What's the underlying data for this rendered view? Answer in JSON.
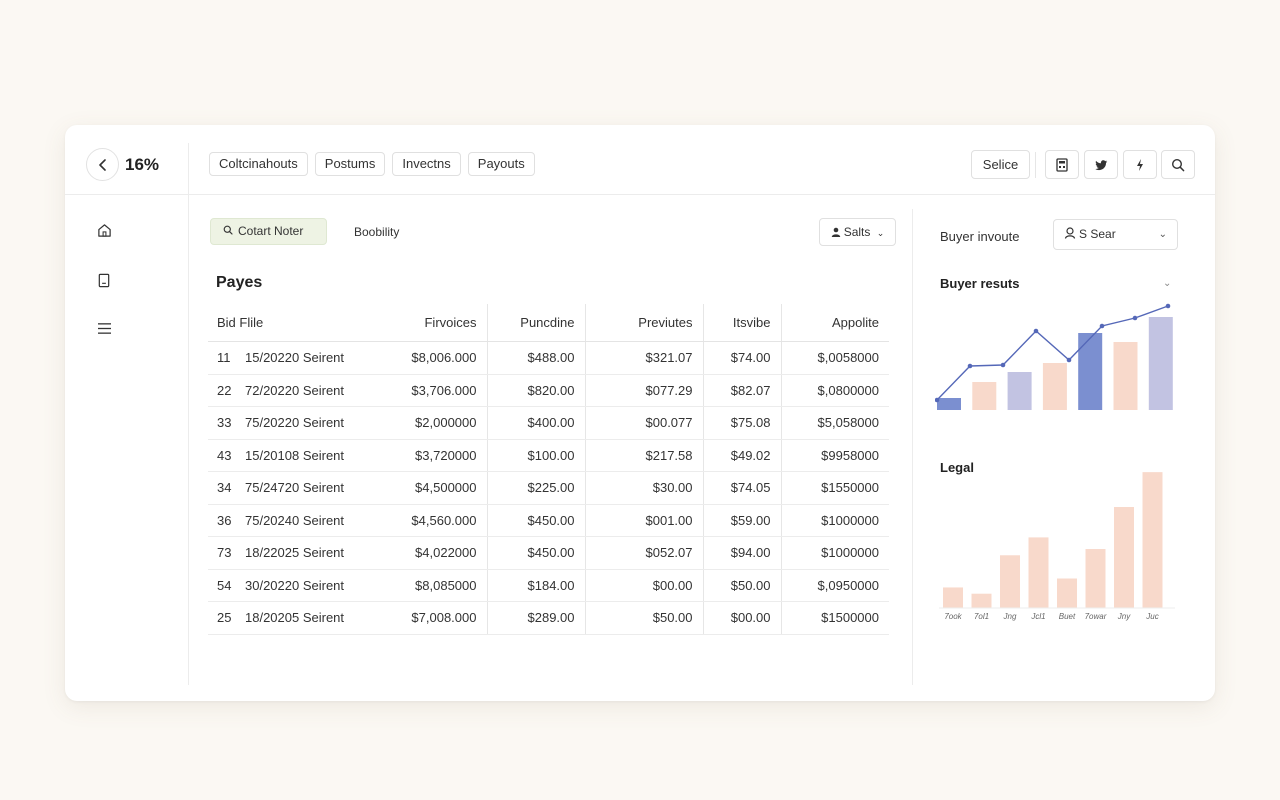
{
  "header": {
    "zoom": "16%",
    "tabs": [
      "Coltcinahouts",
      "Postums",
      "Invectns",
      "Payouts"
    ],
    "select_label": "Selice"
  },
  "icons": {
    "back": "back-arrow-icon",
    "toolbar": [
      "calculator-icon",
      "twitter-bird-icon",
      "lightning-icon",
      "search-icon"
    ],
    "sidebar": [
      "home-icon",
      "document-icon",
      "menu-icon"
    ]
  },
  "filters": {
    "chip_label": "Cotart Noter",
    "visibility_label": "Boobility",
    "sales_label": "Salts"
  },
  "table": {
    "title": "Payes",
    "columns": [
      "Bid Flile",
      "Firvoices",
      "Puncdine",
      "Previutes",
      "Itsvibe",
      "Appolite"
    ],
    "rows": [
      [
        "11",
        "15/20220 Seirent",
        "$8,006.000",
        "$488.00",
        "$321.07",
        "$74.00",
        "$,0058000"
      ],
      [
        "22",
        "72/20220 Seirent",
        "$3,706.000",
        "$820.00",
        "$077.29",
        "$82.07",
        "$,0800000"
      ],
      [
        "33",
        "75/20220 Seirent",
        "$2,000000",
        "$400.00",
        "$00.077",
        "$75.08",
        "$5,058000"
      ],
      [
        "43",
        "15/20108 Seirent",
        "$3,720000",
        "$100.00",
        "$217.58",
        "$49.02",
        "$9958000"
      ],
      [
        "34",
        "75/24720 Seirent",
        "$4,500000",
        "$225.00",
        "$30.00",
        "$74.05",
        "$1550000"
      ],
      [
        "36",
        "75/20240 Seirent",
        "$4,560.000",
        "$450.00",
        "$001.00",
        "$59.00",
        "$1000000"
      ],
      [
        "73",
        "18/22025 Seirent",
        "$4,022000",
        "$450.00",
        "$052.07",
        "$94.00",
        "$1000000"
      ],
      [
        "54",
        "30/20220 Seirent",
        "$8,085000",
        "$184.00",
        "$00.00",
        "$50.00",
        "$,0950000"
      ],
      [
        "25",
        "18/20205 Seirent",
        "$7,008.000",
        "$289.00",
        "$50.00",
        "$00.00",
        "$1500000"
      ]
    ]
  },
  "right_panel": {
    "buyer_label": "Buyer invoute",
    "search_value": "S Sear",
    "chart1_title": "Buyer resuts",
    "chart2_title": "Legal"
  },
  "chart_data": [
    {
      "type": "bar",
      "title": "Buyer resuts",
      "bars": [
        12,
        28,
        38,
        47,
        77,
        68,
        93
      ],
      "bar_colors": [
        "#7b8fd0",
        "#f8d9cb",
        "#c2c3e2",
        "#f8d9cb",
        "#7b8fd0",
        "#f8d9cb",
        "#c2c3e2"
      ],
      "line": [
        10,
        44,
        45,
        79,
        50,
        84,
        92,
        104
      ],
      "line_color": "#5568b8",
      "ylim": [
        0,
        110
      ]
    },
    {
      "type": "bar",
      "title": "Legal",
      "categories": [
        "7ook",
        "7ol1",
        "Jng",
        "Jcl1",
        "Buet",
        "7owar",
        "Jny",
        "Juc"
      ],
      "values": [
        23,
        16,
        59,
        79,
        33,
        66,
        113,
        152
      ],
      "color": "#f8d9cb",
      "ylim": [
        0,
        160
      ]
    }
  ]
}
